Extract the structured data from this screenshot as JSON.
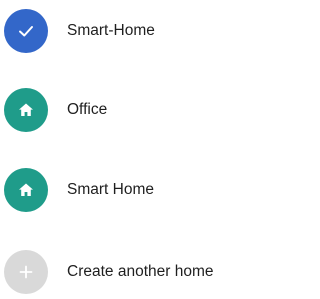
{
  "homes": [
    {
      "label": "Smart-Home",
      "icon": "checkmark-icon",
      "color": "#3367c9",
      "selected": true
    },
    {
      "label": "Office",
      "icon": "house-icon",
      "color": "#1f9c8a",
      "selected": false
    },
    {
      "label": "Smart Home",
      "icon": "house-icon",
      "color": "#1f9c8a",
      "selected": false
    }
  ],
  "create_home": {
    "label": "Create another home",
    "icon": "plus-icon",
    "color": "#d9d9d9"
  }
}
